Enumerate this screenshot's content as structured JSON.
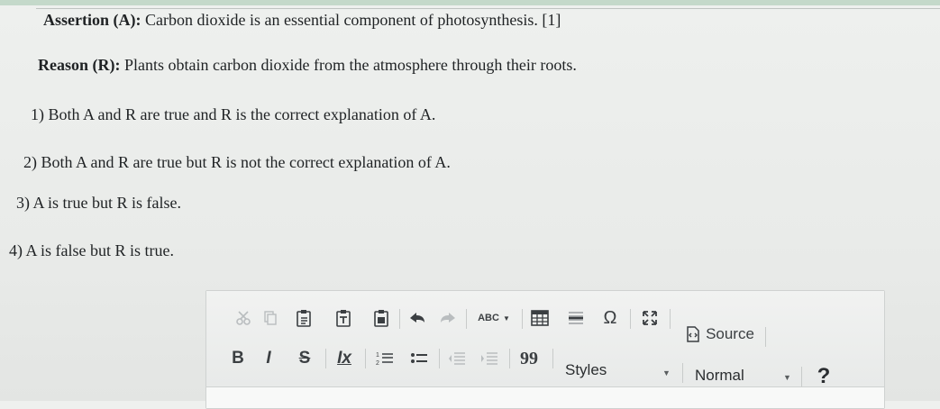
{
  "question": {
    "assertion_label": "Assertion (A):",
    "assertion_text": "Carbon dioxide is an essential component of photosynthesis. [1]",
    "reason_label": "Reason (R):",
    "reason_text": "Plants obtain carbon dioxide from the atmosphere through their roots.",
    "options": [
      "1) Both A and R are true and R is the correct explanation of A.",
      "2) Both A and R are true but R is not the correct explanation of A.",
      "3) A is true but R is false.",
      "4) A is false but R is true."
    ]
  },
  "toolbar": {
    "spell_label": "ABC",
    "source_label": "Source",
    "bold_label": "B",
    "italic_label": "I",
    "strike_label": "S",
    "removeformat_label": "Ix",
    "styles_label": "Styles",
    "format_label": "Normal",
    "help_label": "?",
    "blockquote_label": "99",
    "omega_label": "Ω"
  },
  "colors": {
    "accent_help": "#2a2d30",
    "icon": "#3b3f42",
    "disabled_icon": "#b9bdbf"
  }
}
